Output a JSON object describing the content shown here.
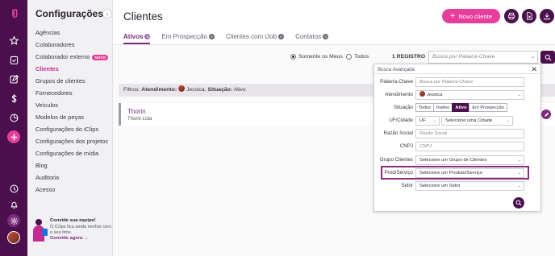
{
  "colors": {
    "rail": "#4a0f4c",
    "accent": "#e83e9b",
    "purple": "#7b2c7d"
  },
  "rail": {
    "icons": [
      "clips-logo-icon",
      "star-icon",
      "clipboard-check-icon",
      "edit-note-icon",
      "dollar-icon",
      "clock-chart-icon",
      "plus-icon",
      "history-icon",
      "bell-icon",
      "gear-icon",
      "user-avatar"
    ]
  },
  "sidebar": {
    "title": "Configurações",
    "items": [
      {
        "label": "Agências"
      },
      {
        "label": "Colaboradores"
      },
      {
        "label": "Colaborador externo",
        "badge": "NOVO"
      },
      {
        "label": "Clientes",
        "active": true
      },
      {
        "label": "Grupos de clientes"
      },
      {
        "label": "Fornecedores"
      },
      {
        "label": "Veículos"
      },
      {
        "label": "Modelos de peças"
      },
      {
        "label": "Configurações do iClips"
      },
      {
        "label": "Configurações dos projetos"
      },
      {
        "label": "Configurações de mídia"
      },
      {
        "label": "Blog"
      },
      {
        "label": "Auditoria"
      },
      {
        "label": "Acesso"
      }
    ],
    "invite": {
      "title": "Convide sua equipe!",
      "text": "O iClips fica ainda melhor com o seu time.",
      "link": "Convide agora",
      "arrow": "→"
    }
  },
  "header": {
    "title": "Clientes",
    "new_button": "Novo cliente",
    "plus": "+",
    "tabs": [
      {
        "label": "Ativos",
        "count": "1"
      },
      {
        "label": "Em Prospecção",
        "count": "0"
      },
      {
        "label": "Clientes com iJob",
        "count": "0"
      },
      {
        "label": "Contatos",
        "count": "0"
      }
    ]
  },
  "filterbar": {
    "scope_mine": "Somente os Meus",
    "scope_all": "Todos",
    "records": "1 REGISTRO",
    "search_placeholder": "Busca por Palavra-Chave",
    "chevron": "⌄"
  },
  "active_filters": {
    "prefix": "Filtros:",
    "atendimento_label": "Atendimento:",
    "atendimento_value": "Jessica",
    "situacao_label": "Situação:",
    "situacao_value": "Ativo"
  },
  "client": {
    "name": "Thorin",
    "company": "Thorin Ltda"
  },
  "advanced": {
    "title": "Busca Avançada",
    "close": "✕",
    "fields": {
      "keyword_label": "Palavra-Chave",
      "keyword_placeholder": "Busca por Palavra-Chave",
      "atendimento_label": "Atendimento",
      "atendimento_value": "Jessica",
      "situacao_label": "Situação",
      "situacao_options": [
        "Todos",
        "Inativo",
        "Ativo",
        "Em Prospecção"
      ],
      "uf_label": "UF/Cidade",
      "uf_value": "UF",
      "cidade_value": "Selecione uma Cidade",
      "razao_label": "Razão Social",
      "razao_placeholder": "Razão Social",
      "cnpj_label": "CNPJ",
      "cnpj_placeholder": "CNPJ",
      "grupo_label": "Grupo Clientes",
      "grupo_value": "Selecione um Grupo de Clientes",
      "prod_label": "Prod/Serviço",
      "prod_value": "Selecione um Produto/Serviço",
      "setor_label": "Setor",
      "setor_value": "Selecione um Setor"
    }
  }
}
